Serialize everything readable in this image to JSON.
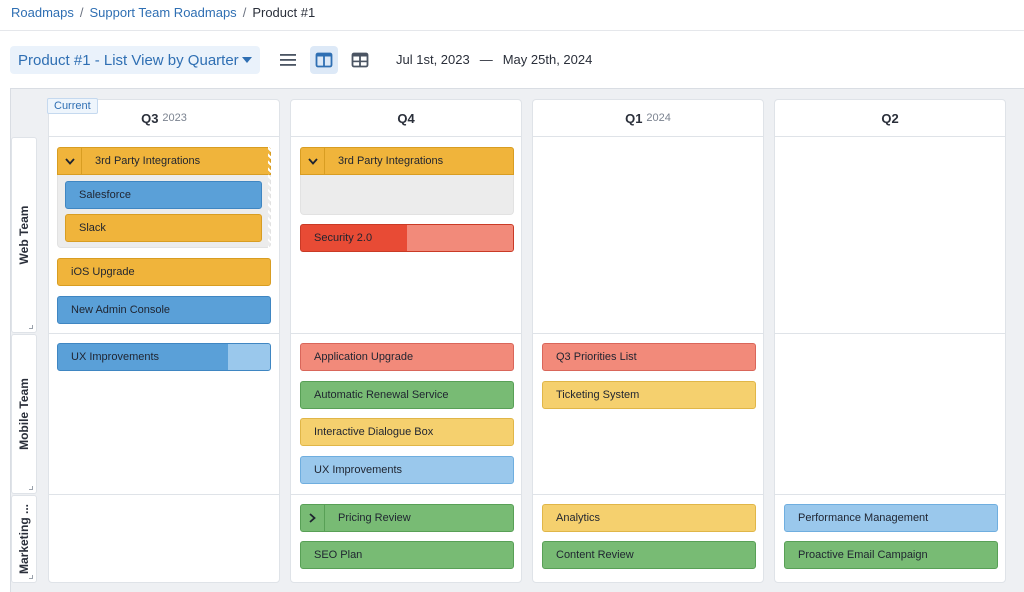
{
  "breadcrumb": {
    "items": [
      "Roadmaps",
      "Support Team Roadmaps"
    ],
    "separator": "/",
    "current": "Product #1"
  },
  "toolbar": {
    "view_label": "Product #1 - List View by Quarter",
    "icons": [
      "list-view-icon",
      "column-view-icon",
      "table-view-icon"
    ],
    "active_view": "column-view-icon",
    "date_start": "Jul 1st, 2023",
    "date_sep": "—",
    "date_end": "May 25th, 2024"
  },
  "board": {
    "rows": [
      "Web Team",
      "Mobile Team",
      "Marketing ..."
    ],
    "columns": [
      {
        "quarter": "Q3",
        "year": "2023",
        "badge": "Current"
      },
      {
        "quarter": "Q4",
        "year": "",
        "badge": ""
      },
      {
        "quarter": "Q1",
        "year": "2024",
        "badge": ""
      },
      {
        "quarter": "Q2",
        "year": "",
        "badge": ""
      }
    ],
    "cards": {
      "q3_web_group": "3rd Party Integrations",
      "q3_salesforce": "Salesforce",
      "q3_slack": "Slack",
      "q3_ios": "iOS Upgrade",
      "q3_admin": "New Admin Console",
      "q3_ux": "UX Improvements",
      "q4_web_group": "3rd Party Integrations",
      "q4_security": "Security 2.0",
      "q4_app_upgrade": "Application Upgrade",
      "q4_renewal": "Automatic Renewal Service",
      "q4_dialogue": "Interactive Dialogue Box",
      "q4_ux": "UX Improvements",
      "q4_pricing": "Pricing Review",
      "q4_seo": "SEO Plan",
      "q1_priorities": "Q3 Priorities List",
      "q1_ticketing": "Ticketing System",
      "q1_analytics": "Analytics",
      "q1_content": "Content Review",
      "q2_performance": "Performance Management",
      "q2_email": "Proactive Email Campaign"
    },
    "progress": {
      "q3_ux": 0.8,
      "q4_security": 0.5
    },
    "colors": {
      "orange": "#f0b43b",
      "blue": "#5aa0d8",
      "red": "#f28a7a",
      "red_strong": "#e84b35",
      "green": "#78bb74",
      "yellow": "#f5d06e",
      "light_blue": "#9ac8ec",
      "accent": "#2f6fb3"
    }
  }
}
